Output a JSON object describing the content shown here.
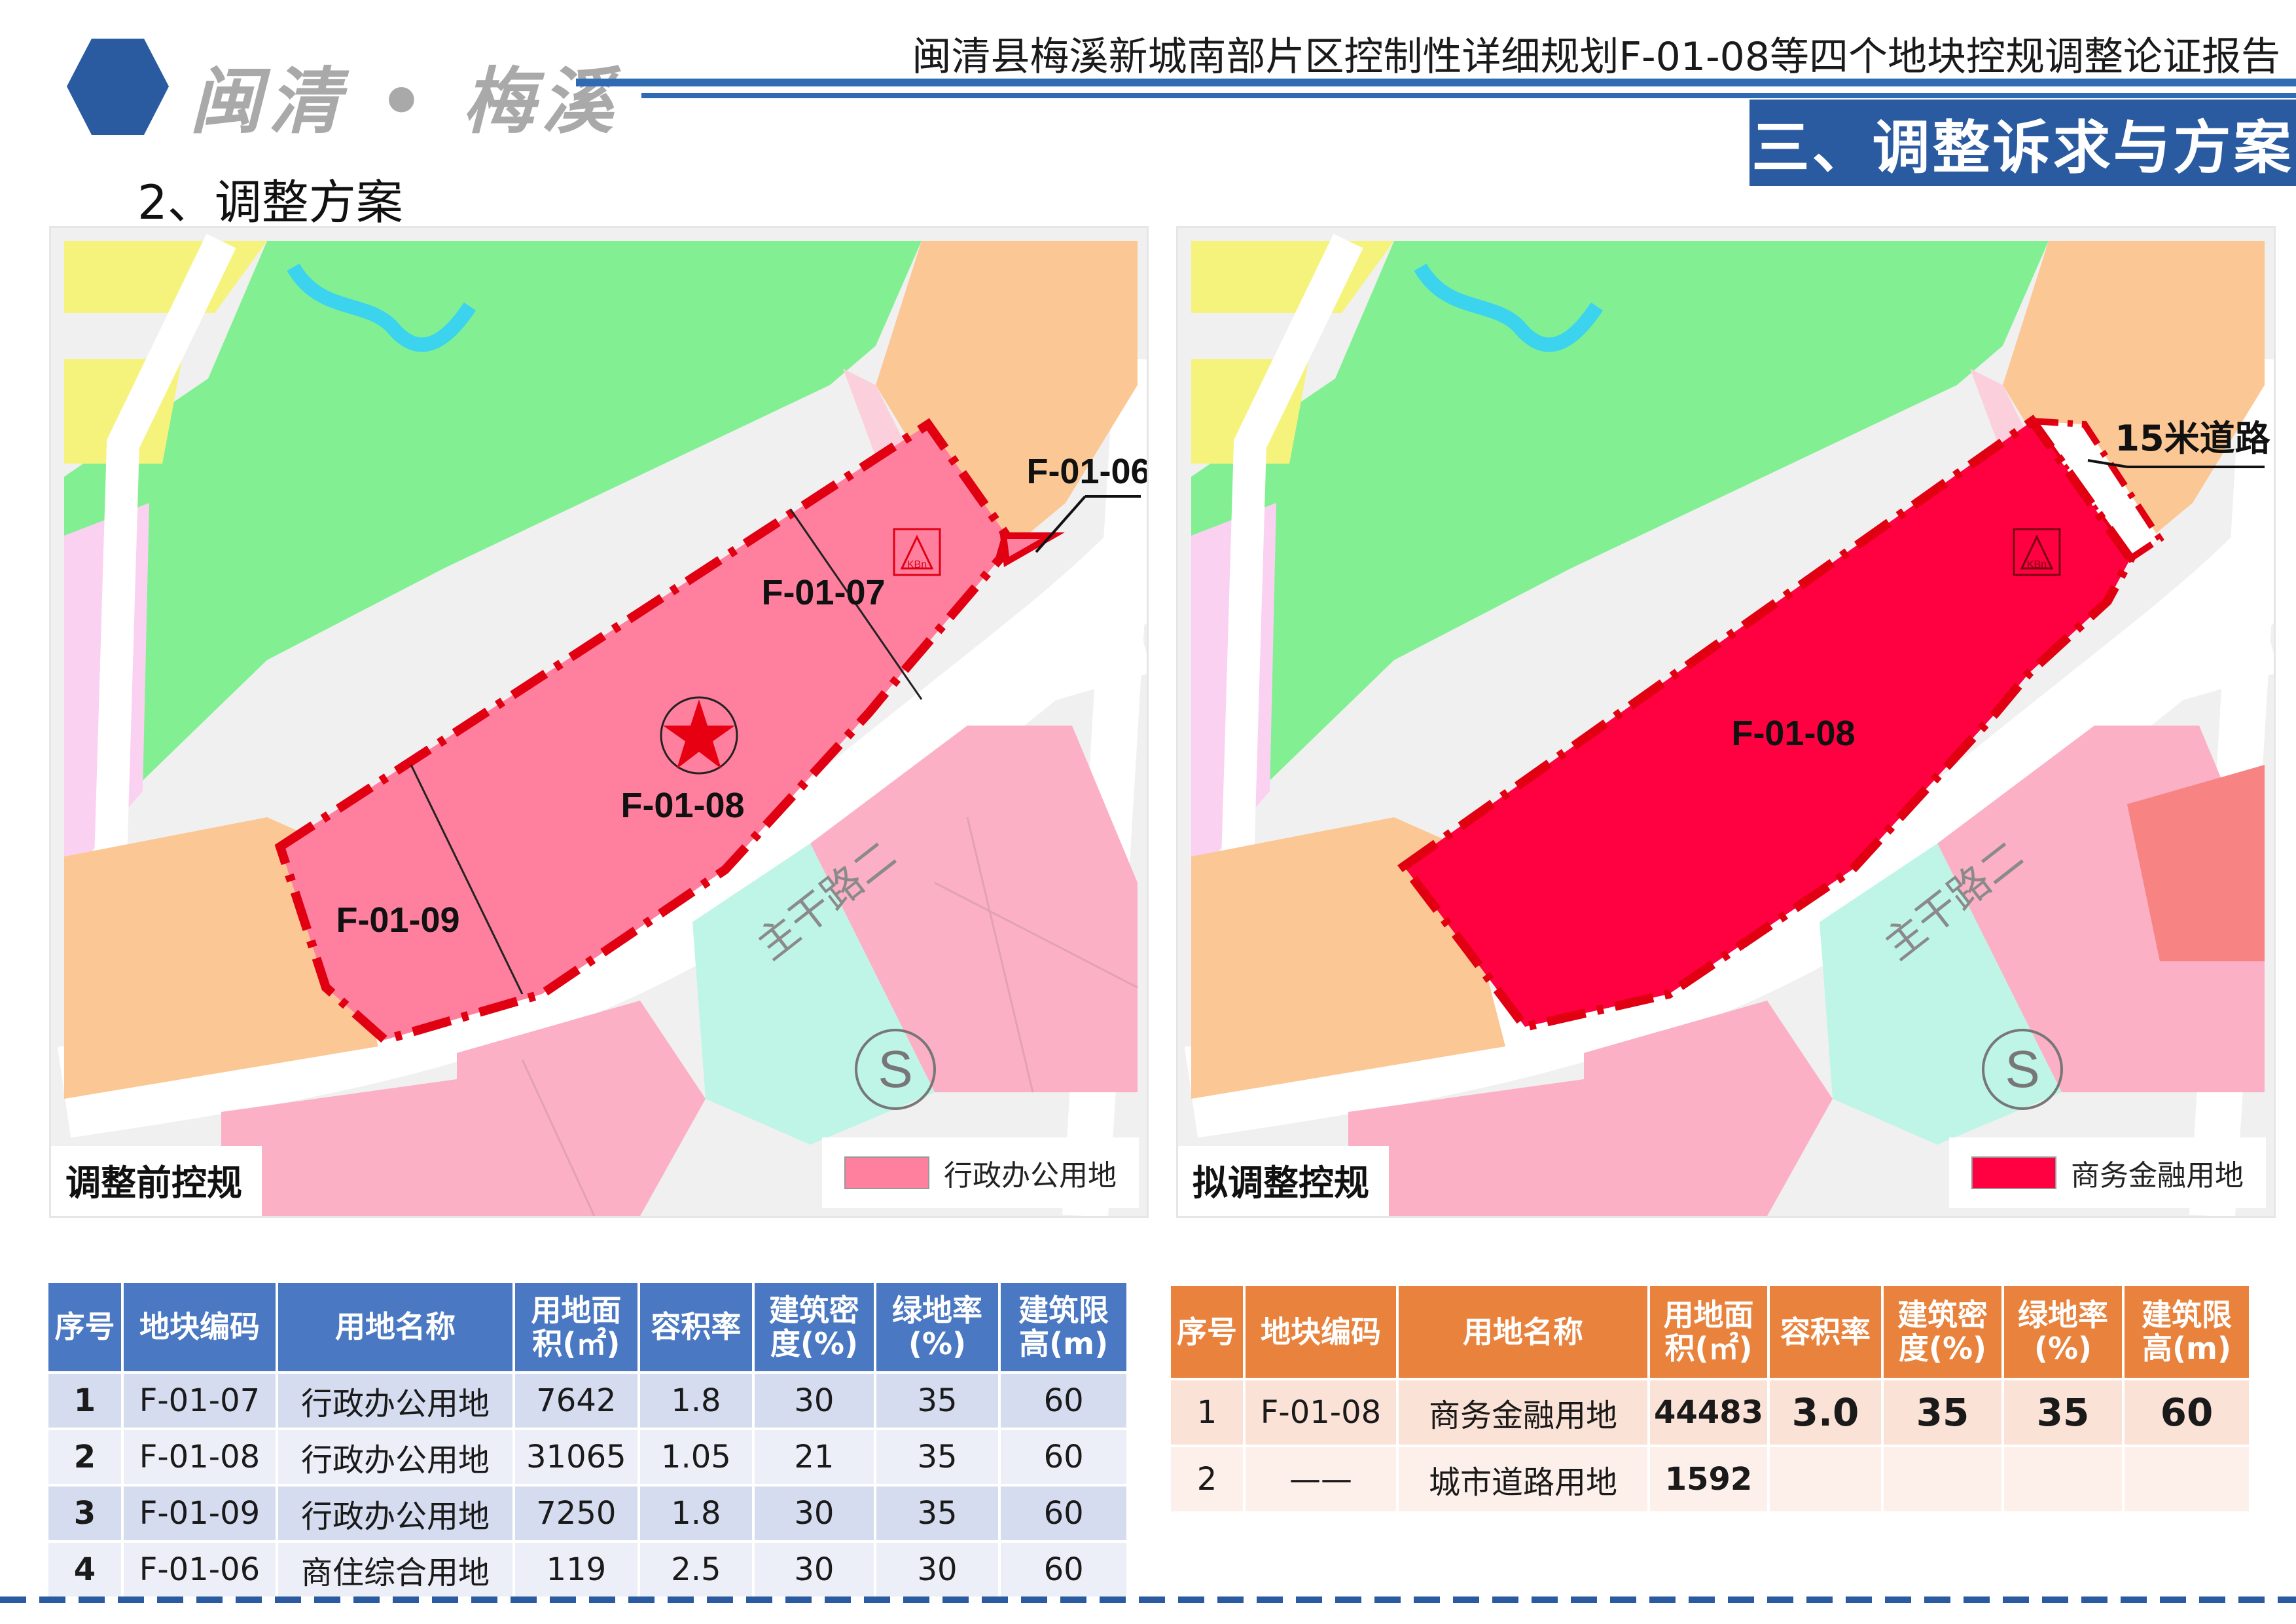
{
  "header": {
    "logo_text": "闽清 • 梅溪",
    "report_title": "闽清县梅溪新城南部片区控制性详细规划F-01-08等四个地块控规调整论证报告",
    "section_tag": "三、调整诉求与方案",
    "subsection": "2、调整方案",
    "brand_color": "#2a5aa0"
  },
  "map_before": {
    "caption": "调整前控规",
    "legend_label": "行政办公用地",
    "legend_color": "#ff7f9f",
    "road_label": "主干路二",
    "station_symbol": "S",
    "site_symbol": "KBn",
    "parcels": [
      "F-01-07",
      "F-01-08",
      "F-01-09"
    ],
    "callout": "F-01-06"
  },
  "map_after": {
    "caption": "拟调整控规",
    "legend_label": "商务金融用地",
    "legend_color": "#ff0040",
    "road_label": "主干路二",
    "station_symbol": "S",
    "site_symbol": "KBn",
    "parcel": "F-01-08",
    "callout": "15米道路"
  },
  "table_before": {
    "headers": [
      "序号",
      "地块编码",
      "用地名称",
      "用地面积(㎡)",
      "容积率",
      "建筑密度(%)",
      "绿地率(%)",
      "建筑限高(m)"
    ],
    "rows": [
      [
        "1",
        "F-01-07",
        "行政办公用地",
        "7642",
        "1.8",
        "30",
        "35",
        "60"
      ],
      [
        "2",
        "F-01-08",
        "行政办公用地",
        "31065",
        "1.05",
        "21",
        "35",
        "60"
      ],
      [
        "3",
        "F-01-09",
        "行政办公用地",
        "7250",
        "1.8",
        "30",
        "35",
        "60"
      ],
      [
        "4",
        "F-01-06",
        "商住综合用地",
        "119",
        "2.5",
        "30",
        "30",
        "60"
      ]
    ]
  },
  "table_after": {
    "headers": [
      "序号",
      "地块编码",
      "用地名称",
      "用地面积(㎡)",
      "容积率",
      "建筑密度(%)",
      "绿地率(%)",
      "建筑限高(m)"
    ],
    "rows": [
      [
        "1",
        "F-01-08",
        "商务金融用地",
        "44483",
        "3.0",
        "35",
        "35",
        "60"
      ],
      [
        "2",
        "——",
        "城市道路用地",
        "1592",
        "",
        "",
        "",
        ""
      ]
    ]
  }
}
